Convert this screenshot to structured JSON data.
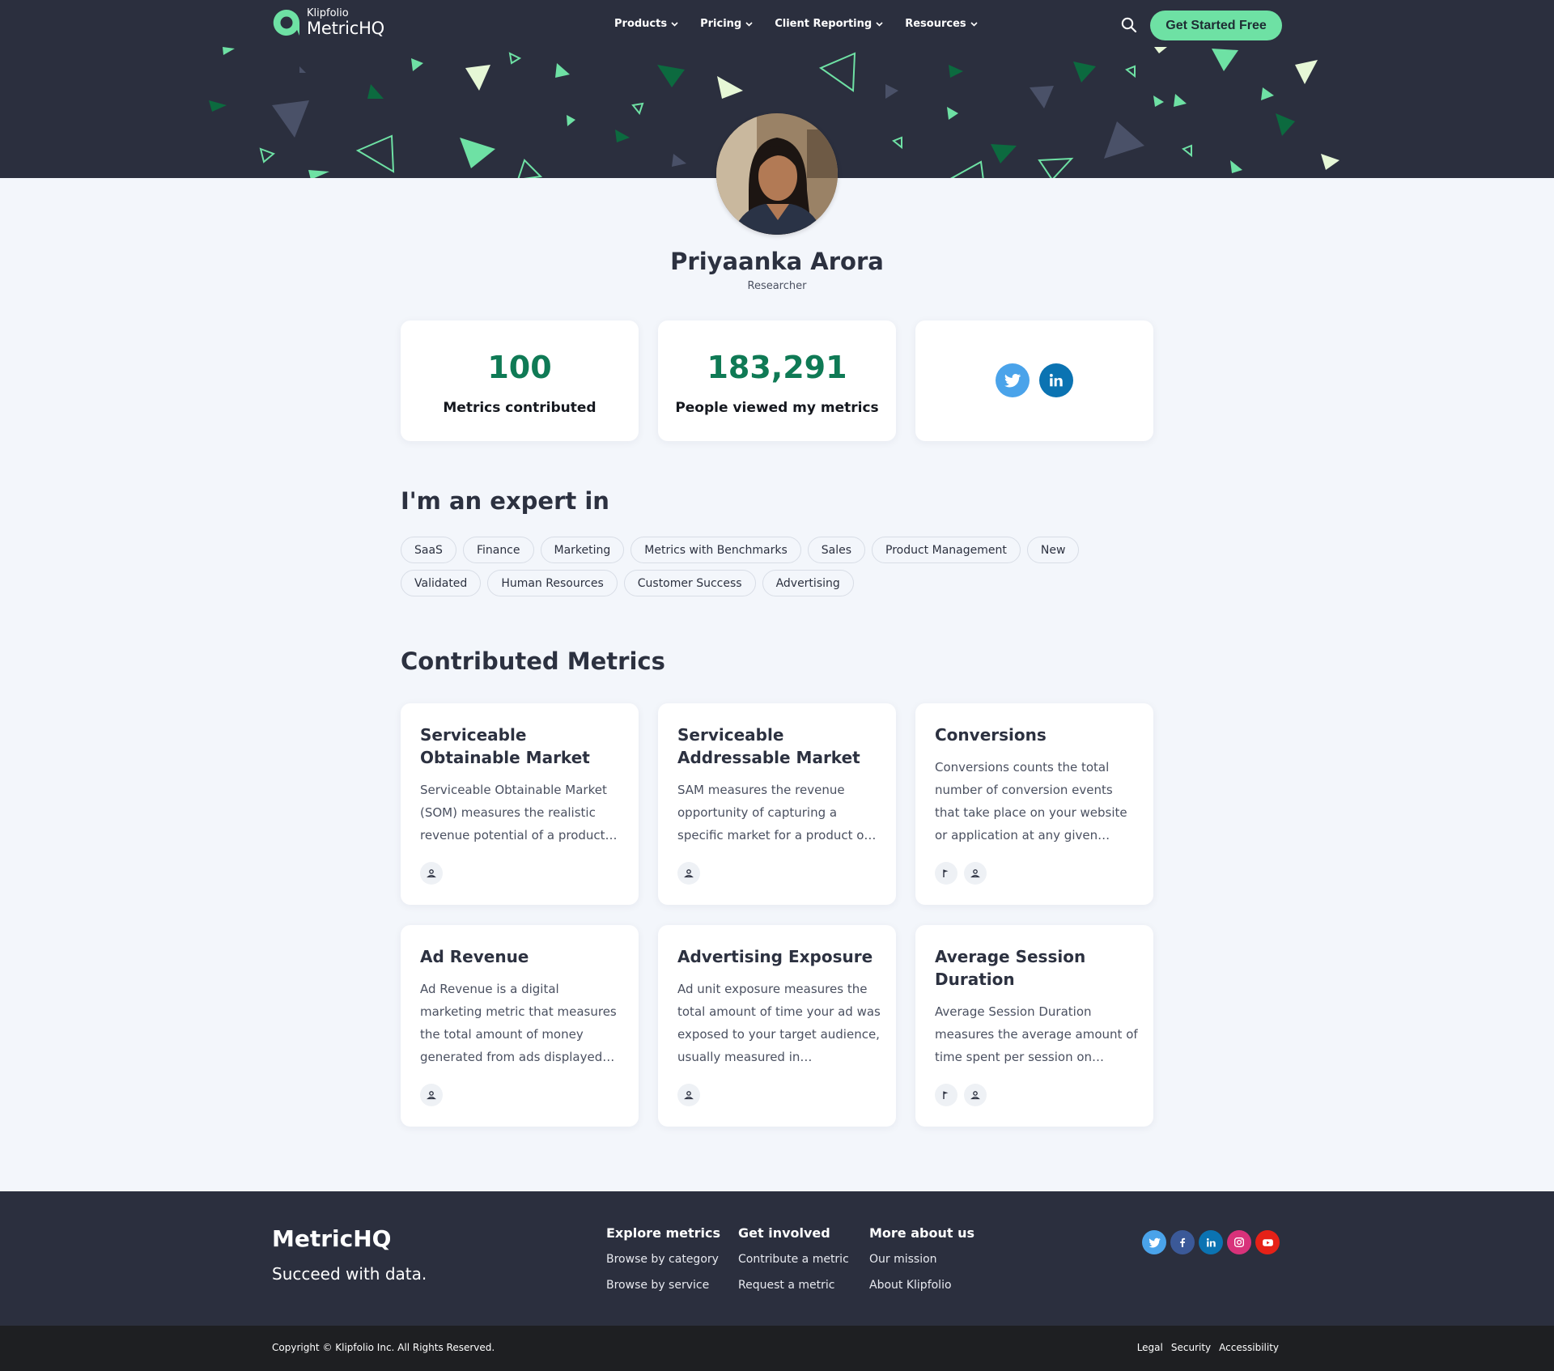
{
  "nav": {
    "logo_small": "Klipfolio",
    "logo_big": "MetricHQ",
    "menu": [
      {
        "label": "Products"
      },
      {
        "label": "Pricing"
      },
      {
        "label": "Client Reporting"
      },
      {
        "label": "Resources"
      }
    ],
    "cta_label": "Get Started Free"
  },
  "profile": {
    "name": "Priyaanka Arora",
    "role": "Researcher"
  },
  "stats": [
    {
      "value": "100",
      "label": "Metrics contributed"
    },
    {
      "value": "183,291",
      "label": "People viewed my metrics"
    }
  ],
  "expert": {
    "title": "I'm an expert in",
    "tags": [
      "SaaS",
      "Finance",
      "Marketing",
      "Metrics with Benchmarks",
      "Sales",
      "Product Management",
      "New",
      "Validated",
      "Human Resources",
      "Customer Success",
      "Advertising"
    ]
  },
  "metrics": {
    "title": "Contributed Metrics",
    "cards": [
      {
        "title": "Serviceable Obtainable Market",
        "desc": "Serviceable Obtainable Market (SOM) measures the realistic revenue potential of a product…",
        "icons": [
          "user-icon"
        ]
      },
      {
        "title": "Serviceable Addressable Market",
        "desc": "SAM measures the revenue opportunity of capturing a specific market for a product o…",
        "icons": [
          "user-icon"
        ]
      },
      {
        "title": "Conversions",
        "desc": "Conversions counts the total number of conversion events that take place on your website or application at any given…",
        "icons": [
          "flag-icon",
          "user-icon"
        ]
      },
      {
        "title": "Ad Revenue",
        "desc": "Ad Revenue is a digital marketing metric that measures the total amount of money generated from ads displayed…",
        "icons": [
          "user-icon"
        ]
      },
      {
        "title": "Advertising Exposure",
        "desc": "Ad unit exposure measures the total amount of time your ad was exposed to your target audience, usually measured in…",
        "icons": [
          "user-icon"
        ]
      },
      {
        "title": "Average Session Duration",
        "desc": "Average Session Duration measures the average amount of time spent per session on…",
        "icons": [
          "flag-icon",
          "user-icon"
        ]
      }
    ]
  },
  "footer": {
    "brand": "MetricHQ",
    "tagline": "Succeed with data.",
    "columns": [
      {
        "title": "Explore metrics",
        "links": [
          "Browse by category",
          "Browse by service"
        ]
      },
      {
        "title": "Get involved",
        "links": [
          "Contribute a metric",
          "Request a metric"
        ]
      },
      {
        "title": "More about us",
        "links": [
          "Our mission",
          "About Klipfolio"
        ]
      }
    ],
    "copyright": "Copyright © Klipfolio Inc. All Rights Reserved.",
    "legal_links": [
      "Legal",
      "Security",
      "Accessibility"
    ]
  },
  "colors": {
    "header_bg": "#2b2f3e",
    "accent_green": "#6ee1a4",
    "stat_green": "#0f7a55",
    "twitter": "#4aa3ea",
    "linkedin": "#0b73b2",
    "facebook": "#3b5998",
    "instagram": "#d8327a",
    "youtube": "#e62117"
  }
}
